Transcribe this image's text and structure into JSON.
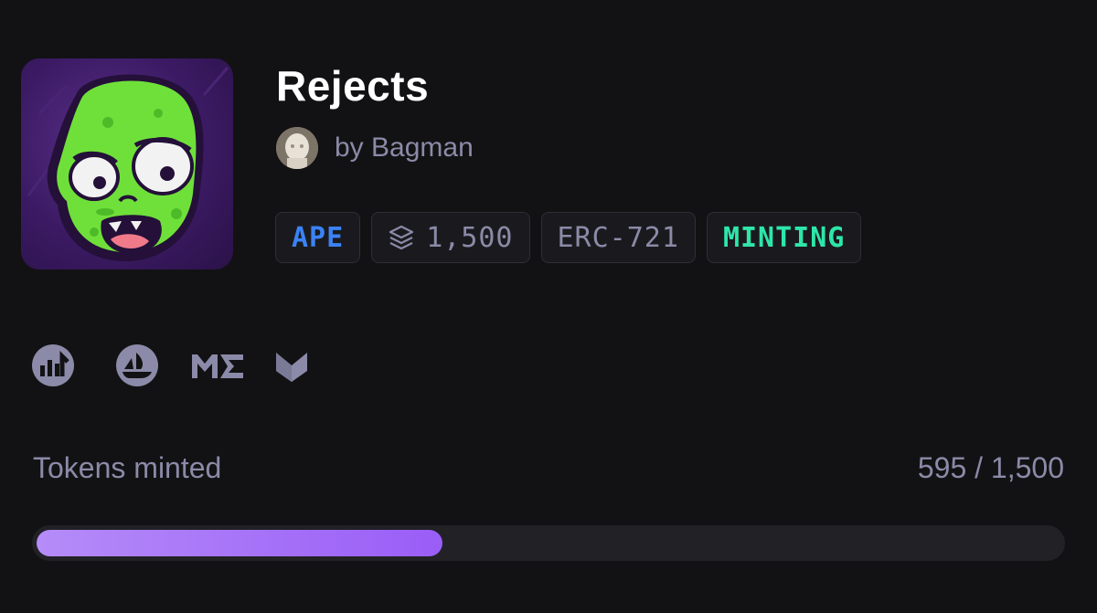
{
  "collection": {
    "title": "Rejects",
    "creator_text": "by Bagman",
    "image_icon": "zombie-head-artwork"
  },
  "badges": {
    "chain": "APE",
    "supply": "1,500",
    "supply_icon": "layers-icon",
    "standard": "ERC-721",
    "status": "MINTING"
  },
  "links": [
    "stats-chart-icon",
    "opensea-icon",
    "magic-eden-icon",
    "marketplace-icon"
  ],
  "progress": {
    "label": "Tokens minted",
    "count_text": "595 / 1,500",
    "minted": 595,
    "total": 1500
  },
  "colors": {
    "background": "#121214",
    "muted_text": "#8b8aa8",
    "chain_blue": "#3b82f6",
    "status_green": "#2ee6a8",
    "progress_purple": "#9a5df7"
  }
}
